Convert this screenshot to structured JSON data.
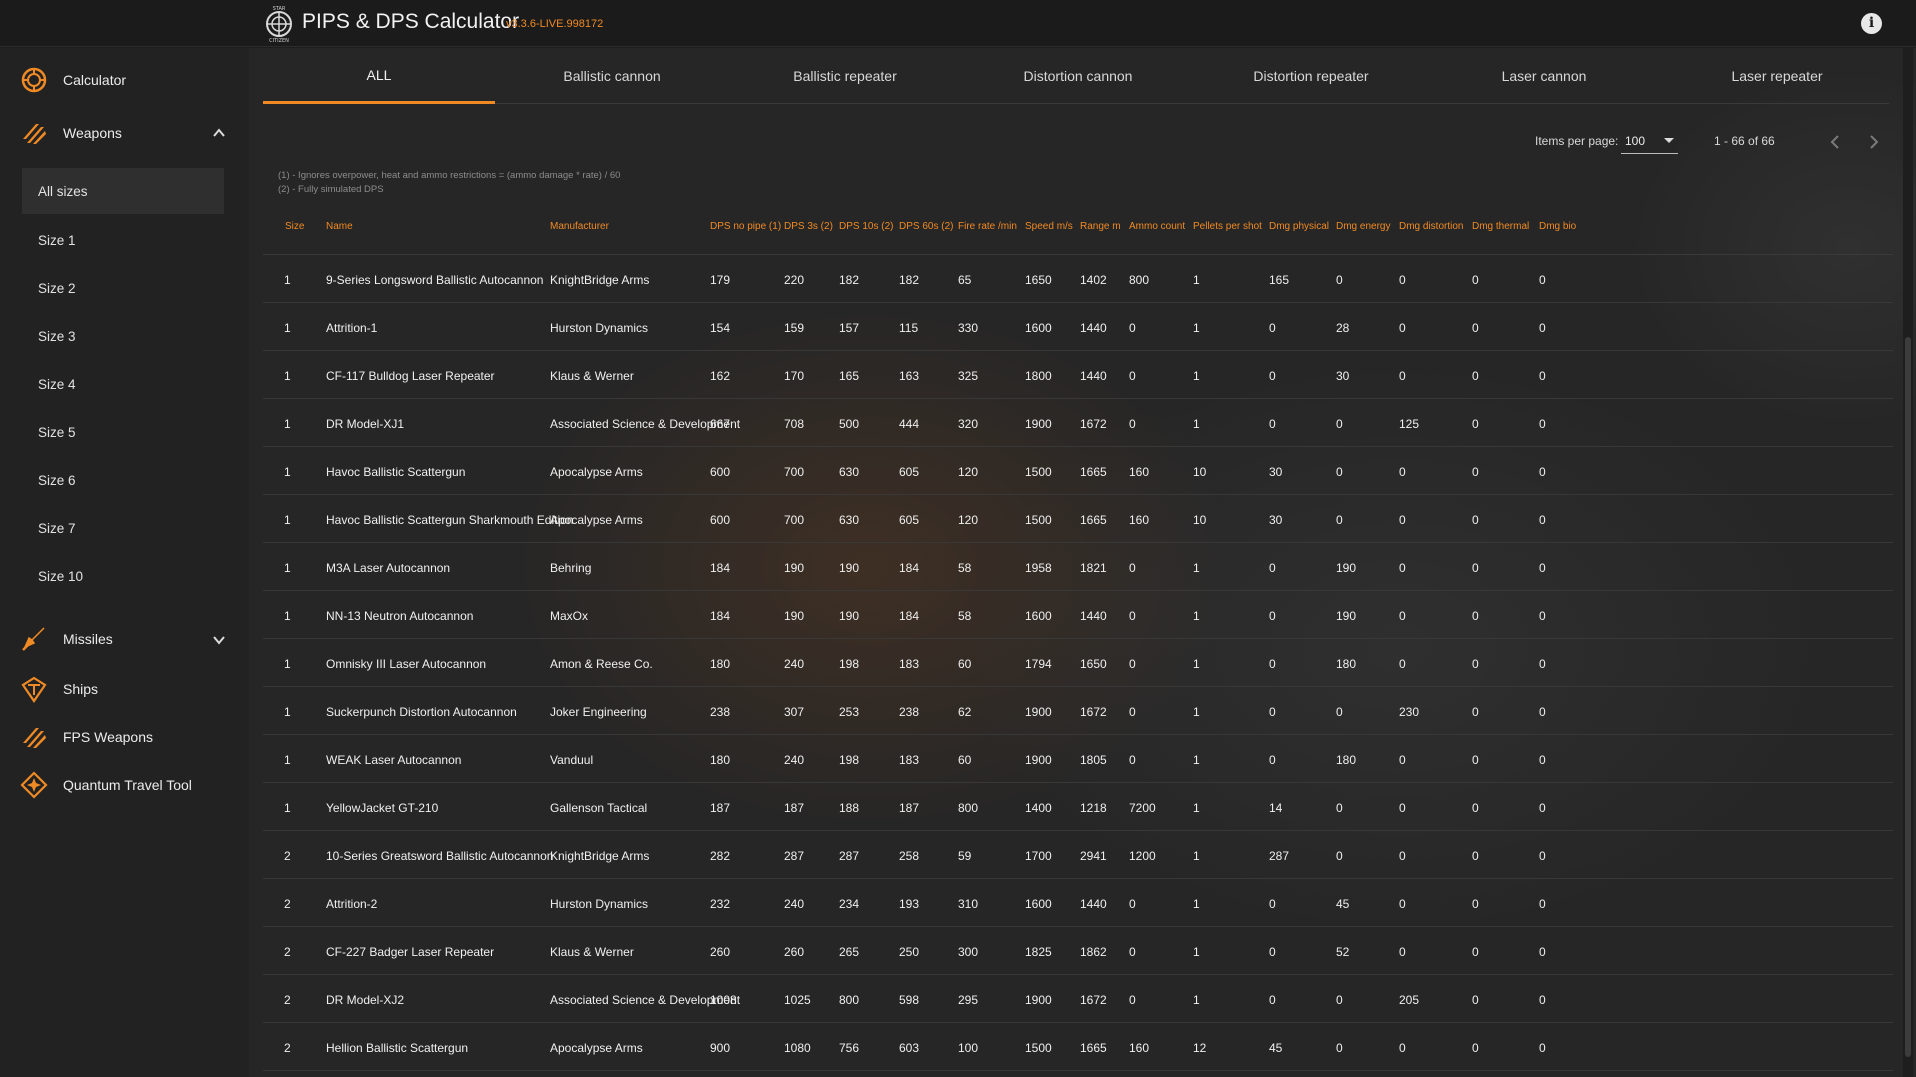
{
  "app": {
    "title": "PIPS & DPS Calculator",
    "version": "v3.3.6-LIVE.998172",
    "accent_color": "#f08a24",
    "logo_icon": "star-citizen-logo-icon",
    "info_icon": "info-icon"
  },
  "sidebar": {
    "calculator": {
      "label": "Calculator",
      "icon": "calculator-icon"
    },
    "weapons": {
      "label": "Weapons",
      "icon": "weapons-icon",
      "expanded": true
    },
    "weapon_sizes": [
      "All sizes",
      "Size 1",
      "Size 2",
      "Size 3",
      "Size 4",
      "Size 5",
      "Size 6",
      "Size 7",
      "Size 10"
    ],
    "active_size": "All sizes",
    "missiles": {
      "label": "Missiles",
      "icon": "missile-icon",
      "expanded": false
    },
    "ships": {
      "label": "Ships",
      "icon": "ship-icon"
    },
    "fps_weapons": {
      "label": "FPS Weapons",
      "icon": "fps-weapons-icon"
    },
    "quantum": {
      "label": "Quantum Travel Tool",
      "icon": "quantum-icon"
    }
  },
  "tabs": [
    "ALL",
    "Ballistic cannon",
    "Ballistic repeater",
    "Distortion cannon",
    "Distortion repeater",
    "Laser cannon",
    "Laser repeater"
  ],
  "active_tab": "ALL",
  "pagination": {
    "items_per_page_label": "Items per page:",
    "items_per_page": "100",
    "range": "1 - 66 of 66"
  },
  "footnotes": [
    "(1) - Ignores overpower, heat and ammo restrictions = (ammo damage * rate) / 60",
    "(2) - Fully simulated DPS"
  ],
  "table": {
    "columns": [
      "Size",
      "Name",
      "Manufacturer",
      "DPS no pipe (1)",
      "DPS 3s (2)",
      "DPS 10s (2)",
      "DPS 60s (2)",
      "Fire rate /min",
      "Speed m/s",
      "Range m",
      "Ammo count",
      "Pellets per shot",
      "Dmg physical",
      "Dmg energy",
      "Dmg distortion",
      "Dmg thermal",
      "Dmg bio"
    ],
    "rows": [
      [
        "1",
        "9-Series Longsword Ballistic Autocannon",
        "KnightBridge Arms",
        "179",
        "220",
        "182",
        "182",
        "65",
        "1650",
        "1402",
        "800",
        "1",
        "165",
        "0",
        "0",
        "0",
        "0"
      ],
      [
        "1",
        "Attrition-1",
        "Hurston Dynamics",
        "154",
        "159",
        "157",
        "115",
        "330",
        "1600",
        "1440",
        "0",
        "1",
        "0",
        "28",
        "0",
        "0",
        "0"
      ],
      [
        "1",
        "CF-117 Bulldog Laser Repeater",
        "Klaus & Werner",
        "162",
        "170",
        "165",
        "163",
        "325",
        "1800",
        "1440",
        "0",
        "1",
        "0",
        "30",
        "0",
        "0",
        "0"
      ],
      [
        "1",
        "DR Model-XJ1",
        "Associated Science & Development",
        "667",
        "708",
        "500",
        "444",
        "320",
        "1900",
        "1672",
        "0",
        "1",
        "0",
        "0",
        "125",
        "0",
        "0"
      ],
      [
        "1",
        "Havoc Ballistic Scattergun",
        "Apocalypse Arms",
        "600",
        "700",
        "630",
        "605",
        "120",
        "1500",
        "1665",
        "160",
        "10",
        "30",
        "0",
        "0",
        "0",
        "0"
      ],
      [
        "1",
        "Havoc Ballistic Scattergun Sharkmouth Edition",
        "Apocalypse Arms",
        "600",
        "700",
        "630",
        "605",
        "120",
        "1500",
        "1665",
        "160",
        "10",
        "30",
        "0",
        "0",
        "0",
        "0"
      ],
      [
        "1",
        "M3A Laser Autocannon",
        "Behring",
        "184",
        "190",
        "190",
        "184",
        "58",
        "1958",
        "1821",
        "0",
        "1",
        "0",
        "190",
        "0",
        "0",
        "0"
      ],
      [
        "1",
        "NN-13 Neutron Autocannon",
        "MaxOx",
        "184",
        "190",
        "190",
        "184",
        "58",
        "1600",
        "1440",
        "0",
        "1",
        "0",
        "190",
        "0",
        "0",
        "0"
      ],
      [
        "1",
        "Omnisky III Laser Autocannon",
        "Amon & Reese Co.",
        "180",
        "240",
        "198",
        "183",
        "60",
        "1794",
        "1650",
        "0",
        "1",
        "0",
        "180",
        "0",
        "0",
        "0"
      ],
      [
        "1",
        "Suckerpunch Distortion Autocannon",
        "Joker Engineering",
        "238",
        "307",
        "253",
        "238",
        "62",
        "1900",
        "1672",
        "0",
        "1",
        "0",
        "0",
        "230",
        "0",
        "0"
      ],
      [
        "1",
        "WEAK Laser Autocannon",
        "Vanduul",
        "180",
        "240",
        "198",
        "183",
        "60",
        "1900",
        "1805",
        "0",
        "1",
        "0",
        "180",
        "0",
        "0",
        "0"
      ],
      [
        "1",
        "YellowJacket GT-210",
        "Gallenson Tactical",
        "187",
        "187",
        "188",
        "187",
        "800",
        "1400",
        "1218",
        "7200",
        "1",
        "14",
        "0",
        "0",
        "0",
        "0"
      ],
      [
        "2",
        "10-Series Greatsword Ballistic Autocannon",
        "KnightBridge Arms",
        "282",
        "287",
        "287",
        "258",
        "59",
        "1700",
        "2941",
        "1200",
        "1",
        "287",
        "0",
        "0",
        "0",
        "0"
      ],
      [
        "2",
        "Attrition-2",
        "Hurston Dynamics",
        "232",
        "240",
        "234",
        "193",
        "310",
        "1600",
        "1440",
        "0",
        "1",
        "0",
        "45",
        "0",
        "0",
        "0"
      ],
      [
        "2",
        "CF-227 Badger Laser Repeater",
        "Klaus & Werner",
        "260",
        "260",
        "265",
        "250",
        "300",
        "1825",
        "1862",
        "0",
        "1",
        "0",
        "52",
        "0",
        "0",
        "0"
      ],
      [
        "2",
        "DR Model-XJ2",
        "Associated Science & Development",
        "1008",
        "1025",
        "800",
        "598",
        "295",
        "1900",
        "1672",
        "0",
        "1",
        "0",
        "0",
        "205",
        "0",
        "0"
      ],
      [
        "2",
        "Hellion Ballistic Scattergun",
        "Apocalypse Arms",
        "900",
        "1080",
        "756",
        "603",
        "100",
        "1500",
        "1665",
        "160",
        "12",
        "45",
        "0",
        "0",
        "0",
        "0"
      ]
    ]
  }
}
